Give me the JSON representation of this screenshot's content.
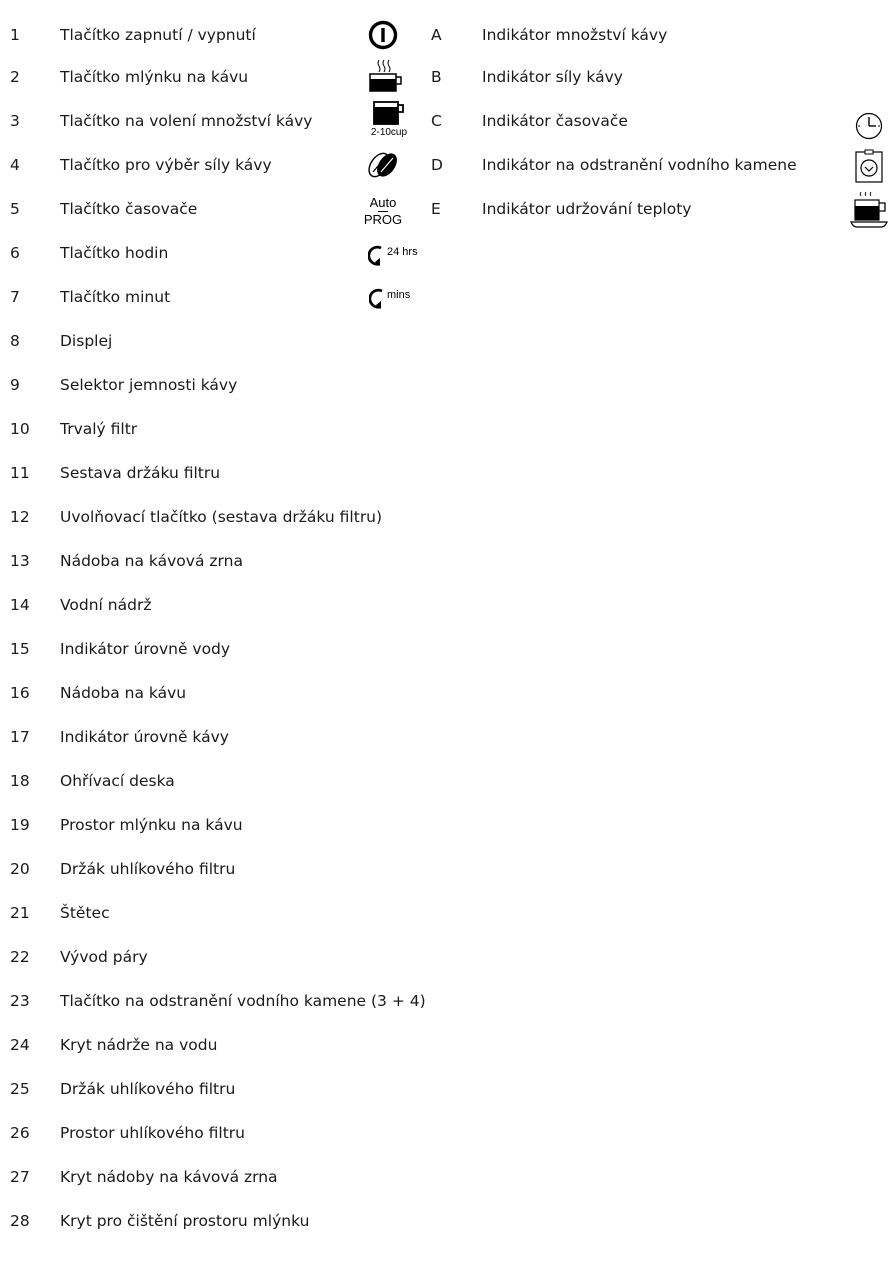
{
  "left_items": [
    {
      "num": "1",
      "label": "Tlačítko zapnutí / vypnutí"
    },
    {
      "num": "2",
      "label": "Tlačítko mlýnku na kávu"
    },
    {
      "num": "3",
      "label": "Tlačítko na volení množství kávy"
    },
    {
      "num": "4",
      "label": "Tlačítko pro výběr síly kávy"
    },
    {
      "num": "5",
      "label": "Tlačítko časovače"
    },
    {
      "num": "6",
      "label": "Tlačítko hodin"
    },
    {
      "num": "7",
      "label": "Tlačítko minut"
    },
    {
      "num": "8",
      "label": "Displej"
    },
    {
      "num": "9",
      "label": "Selektor jemnosti kávy"
    },
    {
      "num": "10",
      "label": "Trvalý filtr"
    },
    {
      "num": "11",
      "label": "Sestava držáku filtru"
    },
    {
      "num": "12",
      "label": "Uvolňovací tlačítko  (sestava držáku filtru)"
    },
    {
      "num": "13",
      "label": "Nádoba na kávová zrna"
    },
    {
      "num": "14",
      "label": "Vodní nádrž"
    },
    {
      "num": "15",
      "label": "Indikátor úrovně vody"
    },
    {
      "num": "16",
      "label": "Nádoba na kávu"
    },
    {
      "num": "17",
      "label": "Indikátor úrovně kávy"
    },
    {
      "num": "18",
      "label": "Ohřívací deska"
    },
    {
      "num": "19",
      "label": "Prostor mlýnku na kávu"
    },
    {
      "num": "20",
      "label": "Držák uhlíkového filtru"
    },
    {
      "num": "21",
      "label": "Štětec"
    },
    {
      "num": "22",
      "label": "Vývod páry"
    },
    {
      "num": "23",
      "label": "Tlačítko na odstranění vodního kamene (3 + 4)"
    },
    {
      "num": "24",
      "label": "Kryt nádrže na vodu"
    },
    {
      "num": "25",
      "label": "Držák uhlíkového filtru"
    },
    {
      "num": "26",
      "label": "Prostor uhlíkového filtru"
    },
    {
      "num": "27",
      "label": "Kryt nádoby na kávová zrna"
    },
    {
      "num": "28",
      "label": "Kryt pro čištění prostoru mlýnku"
    }
  ],
  "right_items": [
    {
      "letter": "A",
      "label": "Indikátor množství kávy"
    },
    {
      "letter": "B",
      "label": "Indikátor síly kávy"
    },
    {
      "letter": "C",
      "label": "Indikátor časovače"
    },
    {
      "letter": "D",
      "label": "Indikátor na odstranění vodního kamene"
    },
    {
      "letter": "E",
      "label": "Indikátor udržování teploty"
    }
  ],
  "icon_text": {
    "cups": "2-10cup",
    "auto": "Auto",
    "prog": "PROG",
    "hours": "24 hrs",
    "mins": "mins"
  }
}
